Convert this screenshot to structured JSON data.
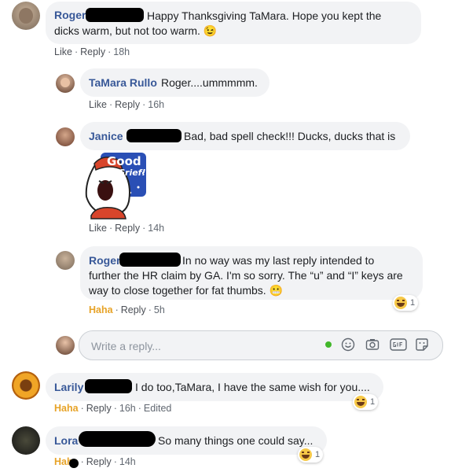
{
  "comments": [
    {
      "id": "roger-1",
      "name": "Roger",
      "text_line1": "Happy Thanksgiving TaMara. Hope you kept the",
      "text_line2": "dicks warm, but not too warm.",
      "emoji": "😉",
      "like": "Like",
      "reply": "Reply",
      "time": "18h"
    },
    {
      "id": "tamara",
      "name": "TaMara Rullo",
      "text": "Roger....ummmmm.",
      "like": "Like",
      "reply": "Reply",
      "time": "16h"
    },
    {
      "id": "janice",
      "name": "Janice",
      "text": "Bad, bad spell check!!! Ducks, ducks that is",
      "sticker_line1": "Good",
      "sticker_line2": "Grief!",
      "like": "Like",
      "reply": "Reply",
      "time": "14h"
    },
    {
      "id": "roger-2",
      "name": "Roger",
      "text_line1": "In no way was my last reply intended to",
      "text_line2": "further the HR claim by GA. I'm so sorry. The “u” and “I” keys are",
      "text_line3": "way to close together for fat thumbs.",
      "emoji": "😬",
      "reaction": "Haha",
      "reply": "Reply",
      "time": "5h",
      "reaction_count": "1"
    },
    {
      "id": "larily",
      "name": "Larily",
      "text": "I do too,TaMara, I have the same wish for you....",
      "reaction": "Haha",
      "reply": "Reply",
      "time": "16h",
      "edited": "Edited",
      "reaction_count": "1"
    },
    {
      "id": "lora",
      "name": "Lora",
      "text": "So many things one could say...",
      "reaction": "Haha",
      "reply": "Reply",
      "time": "14h",
      "reaction_count": "1"
    }
  ],
  "reply_box": {
    "placeholder": "Write a reply..."
  },
  "icons": [
    "emoji-icon",
    "camera-icon",
    "gif-icon",
    "sticker-icon"
  ],
  "colors": {
    "name": "#385898",
    "bubble": "#f2f3f5",
    "meta": "#606770",
    "haha": "#e7a327",
    "online": "#42b72a"
  }
}
